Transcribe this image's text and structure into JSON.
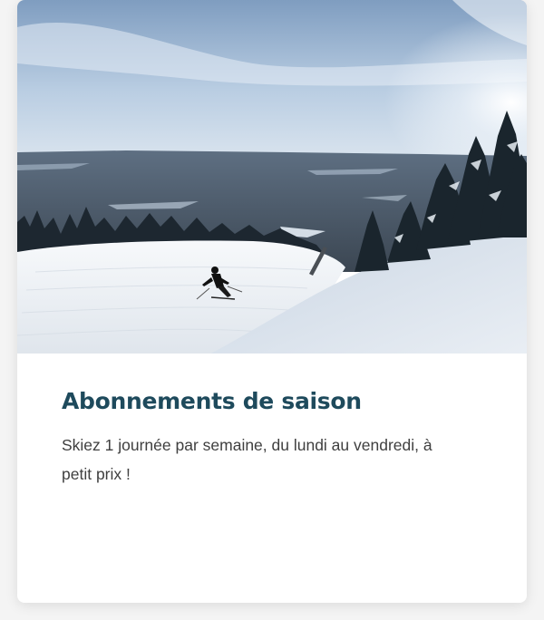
{
  "card": {
    "image_alt": "ski-slope-photo",
    "title": "Abonnements de saison",
    "description": "Skiez 1 journée par semaine, du lundi au vendredi, à petit prix !"
  }
}
